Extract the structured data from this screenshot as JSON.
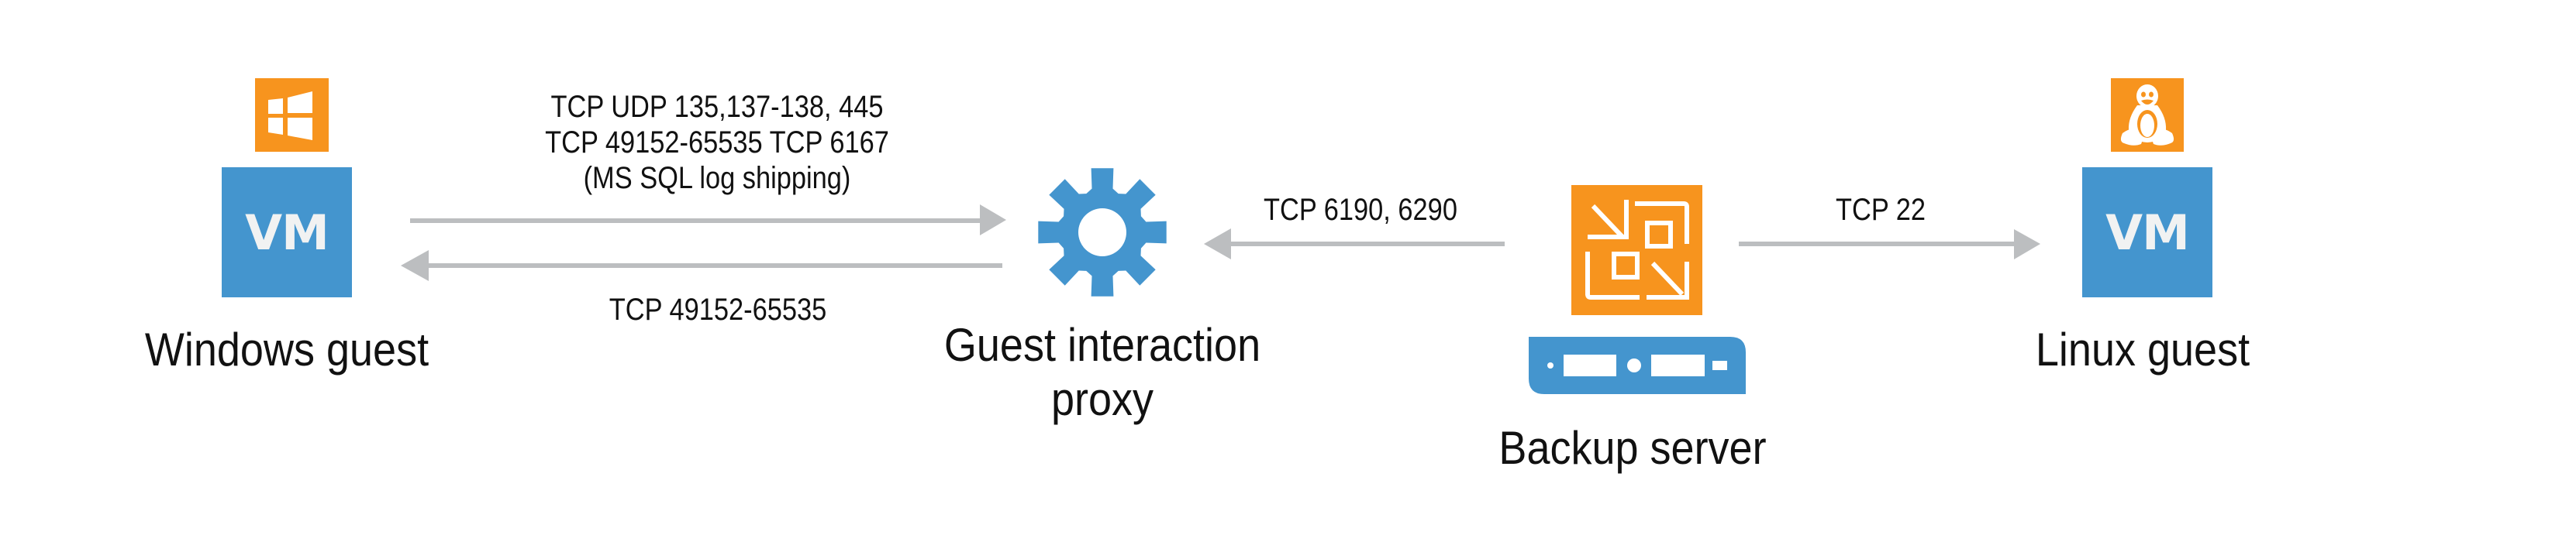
{
  "colors": {
    "orange": "#F7941E",
    "blue": "#4495CE",
    "arrow_gray": "#BCBEC0",
    "text": "#111111",
    "icon_fg": "#FFFFFF",
    "vm_text": "#F1F2F2"
  },
  "nodes": {
    "windows_guest": {
      "label": "Windows guest",
      "badge_icon": "windows-logo-icon",
      "vm_label": "VM"
    },
    "proxy": {
      "label_line1": "Guest interaction",
      "label_line2": "proxy",
      "icon": "gear-icon"
    },
    "backup_server": {
      "label": "Backup server",
      "icon": "veeam-logo-icon",
      "device_icon": "server-icon"
    },
    "linux_guest": {
      "label": "Linux guest",
      "badge_icon": "linux-tux-icon",
      "vm_label": "VM"
    }
  },
  "connections": [
    {
      "from": "proxy",
      "to": "windows_guest",
      "direction": "right",
      "label_lines": [
        "TCP UDP 135,137-138, 445",
        "TCP 49152-65535 TCP 6167",
        "(MS SQL log shipping)"
      ]
    },
    {
      "from": "windows_guest",
      "to": "proxy",
      "direction": "left",
      "label_lines": [
        "TCP 49152-65535"
      ]
    },
    {
      "from": "backup_server",
      "to": "proxy",
      "direction": "left",
      "label_lines": [
        "TCP 6190, 6290"
      ]
    },
    {
      "from": "backup_server",
      "to": "linux_guest",
      "direction": "right",
      "label_lines": [
        "TCP 22"
      ]
    }
  ]
}
